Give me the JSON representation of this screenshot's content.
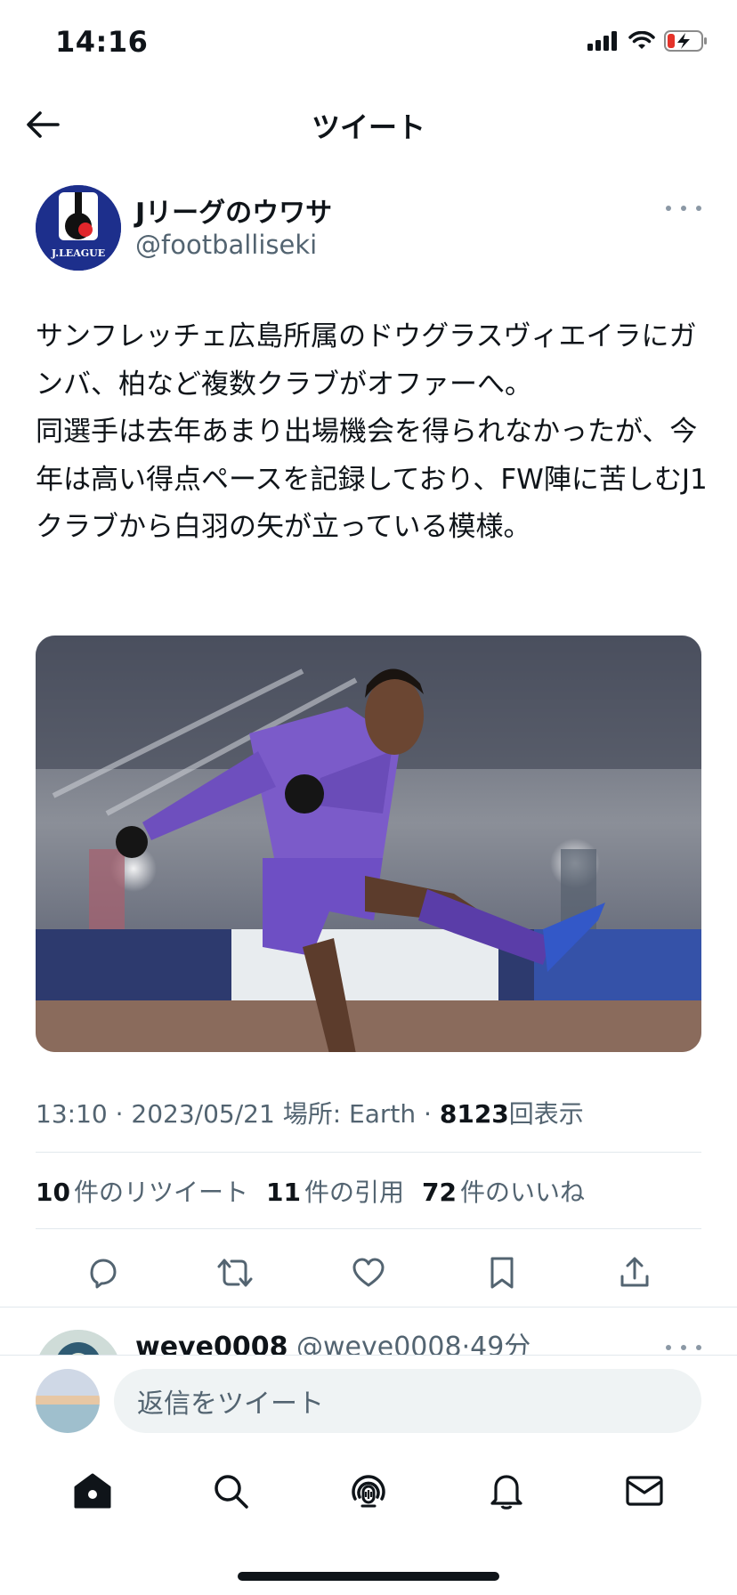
{
  "status_bar": {
    "time": "14:16",
    "icons": [
      "signal-icon",
      "wifi-icon",
      "battery-charging-icon"
    ]
  },
  "header": {
    "title": "ツイート",
    "back_icon": "arrow-left-icon"
  },
  "tweet": {
    "author_name": "Jリーグのウワサ",
    "author_handle": "@footballiseki",
    "avatar_text": "J.LEAGUE",
    "text": "サンフレッチェ広島所属のドウグラスヴィエイラにガンバ、柏など複数クラブがオファーへ。\n同選手は去年あまり出場機会を得られなかったが、今年は高い得点ペースを記録しており、FW陣に苦しむJ1クラブから白羽の矢が立っている模様。",
    "meta": {
      "time": "13:10",
      "date": "2023/05/21",
      "location_label": "場所: Earth",
      "views_count": "8123",
      "views_label": "回表示"
    },
    "stats": {
      "retweets_count": "10",
      "retweets_label": "件のリツイート",
      "quotes_count": "11",
      "quotes_label": "件の引用",
      "likes_count": "72",
      "likes_label": "件のいいね"
    },
    "actions": [
      "reply-icon",
      "retweet-icon",
      "like-icon",
      "bookmark-icon",
      "share-icon"
    ]
  },
  "reply_preview": {
    "name": "weve0008",
    "handle": "@weve0008",
    "time": "49分"
  },
  "compose": {
    "placeholder": "返信をツイート"
  },
  "tabbar": [
    "home-icon",
    "search-icon",
    "spaces-icon",
    "notifications-icon",
    "messages-icon"
  ],
  "colors": {
    "text_primary": "#0f1419",
    "text_secondary": "#536471",
    "divider": "#e1e8ed",
    "jersey_purple": "#7b5bc9"
  }
}
